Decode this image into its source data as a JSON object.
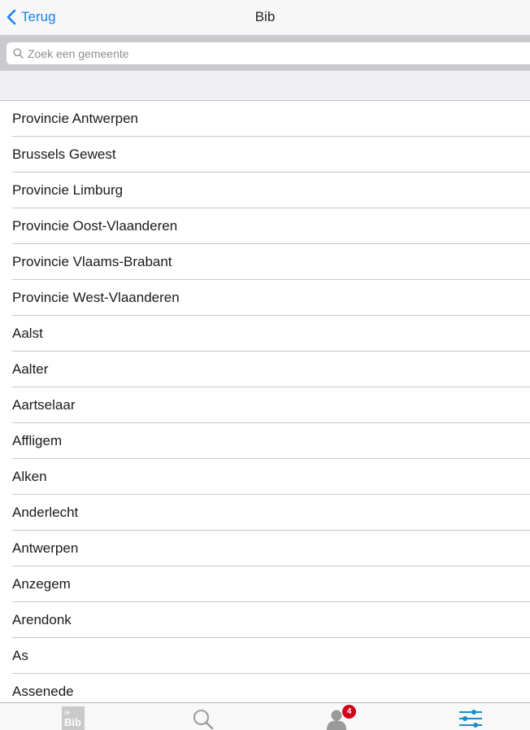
{
  "navbar": {
    "back_label": "Terug",
    "title": "Bib"
  },
  "search": {
    "placeholder": "Zoek een gemeente",
    "value": ""
  },
  "list": {
    "items": [
      "Provincie Antwerpen",
      "Brussels Gewest",
      "Provincie Limburg",
      "Provincie Oost-Vlaanderen",
      "Provincie Vlaams-Brabant",
      "Provincie West-Vlaanderen",
      "Aalst",
      "Aalter",
      "Aartselaar",
      "Affligem",
      "Alken",
      "Anderlecht",
      "Antwerpen",
      "Anzegem",
      "Arendonk",
      "As",
      "Assenede"
    ]
  },
  "tabbar": {
    "tabs": [
      {
        "icon": "bib-logo-icon",
        "logo_text": "Bib"
      },
      {
        "icon": "search-icon"
      },
      {
        "icon": "profile-icon",
        "badge": "4"
      },
      {
        "icon": "settings-sliders-icon",
        "active": true
      }
    ]
  },
  "colors": {
    "accent": "#1a7ff5",
    "badge": "#d0021b",
    "active_tab": "#1a8fc4",
    "inactive_tab": "#9a9a9a"
  }
}
